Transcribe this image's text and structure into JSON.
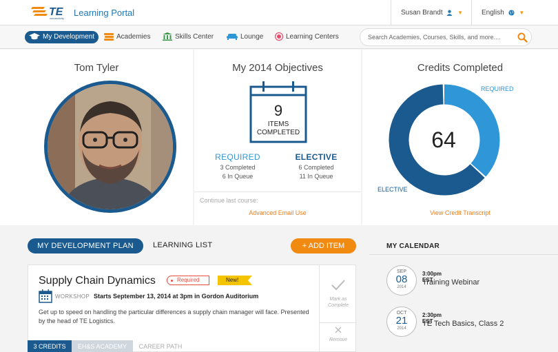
{
  "header": {
    "logo_text": "TE",
    "logo_sub": "connectivity",
    "portal_title": "Learning Portal",
    "user_name": "Susan Brandt",
    "language": "English"
  },
  "nav": {
    "items": [
      {
        "label": "My Development"
      },
      {
        "label": "Academies"
      },
      {
        "label": "Skills Center"
      },
      {
        "label": "Lounge"
      },
      {
        "label": "Learning Centers"
      }
    ],
    "search_placeholder": "Search Academies, Courses, Skills, and more...."
  },
  "profile": {
    "name": "Tom Tyler"
  },
  "objectives": {
    "title": "My 2014 Objectives",
    "completed_count": "9",
    "completed_label_1": "ITEMS",
    "completed_label_2": "COMPLETED",
    "required": {
      "label": "REQUIRED",
      "completed": "3 Completed",
      "queue": "6 In Queue"
    },
    "elective": {
      "label": "ELECTIVE",
      "completed": "6 Completed",
      "queue": "11 In Queue"
    },
    "continue_label": "Continue last course:",
    "continue_link": "Advanced Email Use"
  },
  "credits": {
    "title": "Credits Completed",
    "total": "64",
    "required_label": "REQUIRED",
    "elective_label": "ELECTIVE",
    "required_fraction": 0.37,
    "transcript_link": "View Credit Transcript",
    "colors": {
      "required": "#2f96d8",
      "elective": "#1a5a8f"
    }
  },
  "plan": {
    "tab_plan": "MY DEVELOPMENT PLAN",
    "tab_list": "LEARNING LIST",
    "add_button": "+ ADD ITEM",
    "card": {
      "title": "Supply Chain Dynamics",
      "badge_required": "Required",
      "badge_new": "New!",
      "type": "WORKSHOP",
      "date": "Starts September 13, 2014 at 3pm in Gordon Auditorium",
      "description": "Get up to speed on handling the particular differences a supply chain manager will face. Presented by the head of TE Logistics.",
      "mark_complete_1": "Mark as",
      "mark_complete_2": "Complete",
      "remove": "Remove",
      "tabs": [
        "3 CREDITS",
        "EH&S ACADEMY",
        "CAREER PATH"
      ]
    }
  },
  "calendar": {
    "title": "MY CALENDAR",
    "events": [
      {
        "month": "SEP",
        "day": "08",
        "year": "2014",
        "time": "3:00pm EST",
        "name": "Training Webinar"
      },
      {
        "month": "OCT",
        "day": "21",
        "year": "2014",
        "time": "2:30pm EST",
        "name": "TE Tech Basics, Class 2"
      }
    ]
  }
}
